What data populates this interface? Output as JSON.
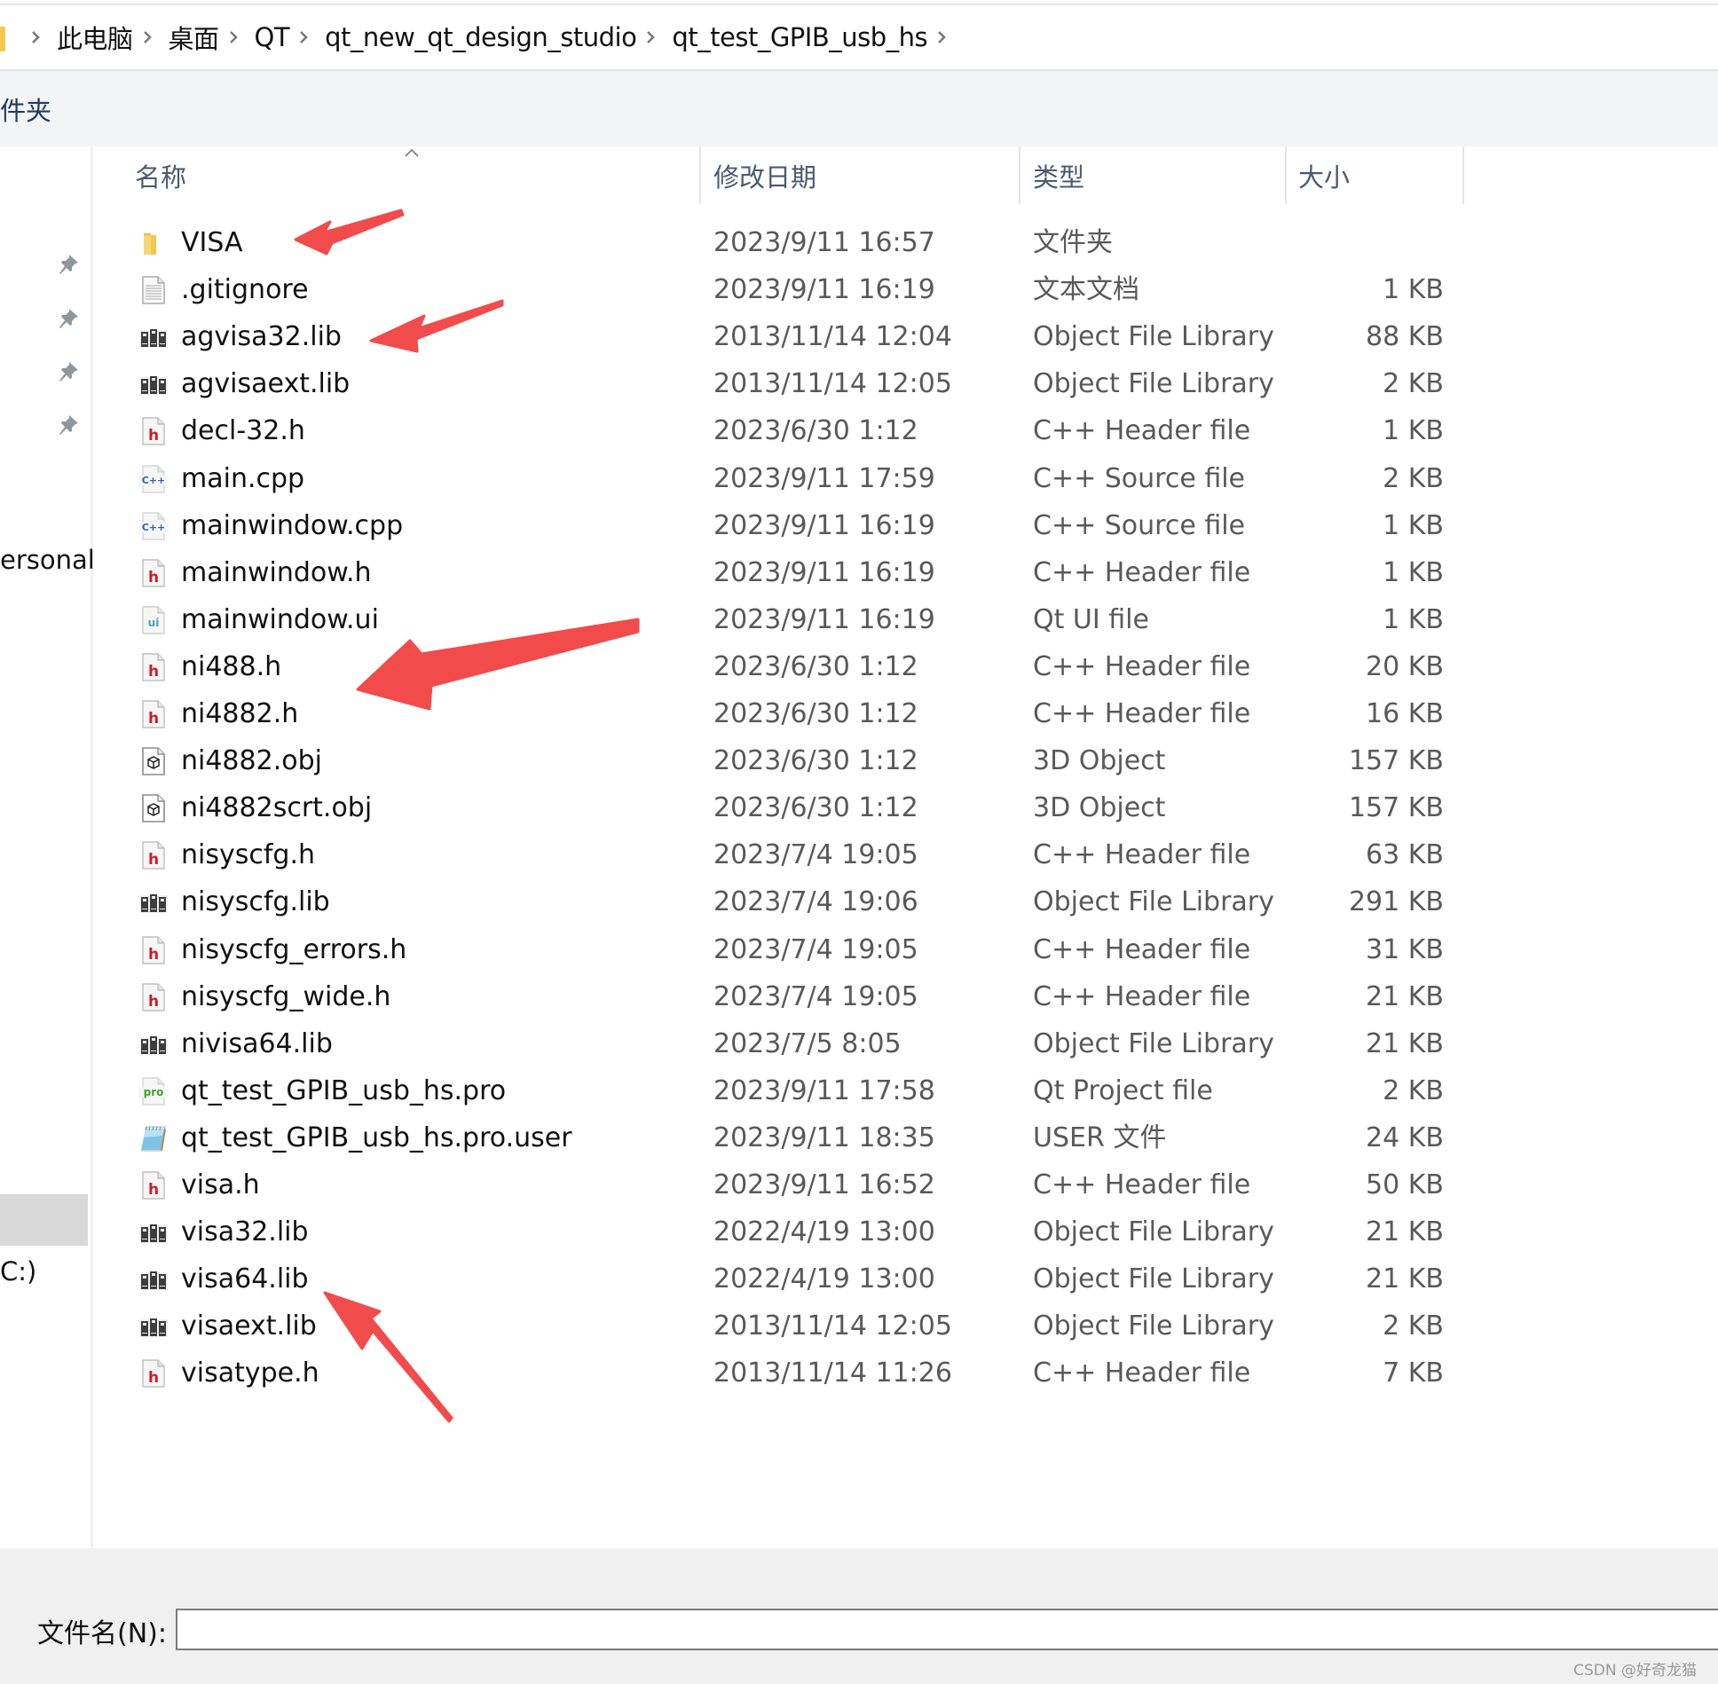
{
  "breadcrumb": {
    "items": [
      "此电脑",
      "桌面",
      "QT",
      "qt_new_qt_design_studio",
      "qt_test_GPIB_usb_hs"
    ]
  },
  "toolbar": {
    "label": "件夹"
  },
  "sidebar": {
    "pinned_count": 4,
    "labels": {
      "personal": "ersonal",
      "drive": "C:)"
    }
  },
  "columns": {
    "name": "名称",
    "date": "修改日期",
    "type": "类型",
    "size": "大小",
    "sort": "name-ascending"
  },
  "files": [
    {
      "name": "VISA",
      "date": "2023/9/11 16:57",
      "type": "文件夹",
      "size": "",
      "icon": "folder"
    },
    {
      "name": ".gitignore",
      "date": "2023/9/11 16:19",
      "type": "文本文档",
      "size": "1 KB",
      "icon": "text"
    },
    {
      "name": "agvisa32.lib",
      "date": "2013/11/14 12:04",
      "type": "Object File Library",
      "size": "88 KB",
      "icon": "lib"
    },
    {
      "name": "agvisaext.lib",
      "date": "2013/11/14 12:05",
      "type": "Object File Library",
      "size": "2 KB",
      "icon": "lib"
    },
    {
      "name": "decl-32.h",
      "date": "2023/6/30 1:12",
      "type": "C++ Header file",
      "size": "1 KB",
      "icon": "header"
    },
    {
      "name": "main.cpp",
      "date": "2023/9/11 17:59",
      "type": "C++ Source file",
      "size": "2 KB",
      "icon": "cpp"
    },
    {
      "name": "mainwindow.cpp",
      "date": "2023/9/11 16:19",
      "type": "C++ Source file",
      "size": "1 KB",
      "icon": "cpp"
    },
    {
      "name": "mainwindow.h",
      "date": "2023/9/11 16:19",
      "type": "C++ Header file",
      "size": "1 KB",
      "icon": "header"
    },
    {
      "name": "mainwindow.ui",
      "date": "2023/9/11 16:19",
      "type": "Qt UI file",
      "size": "1 KB",
      "icon": "ui"
    },
    {
      "name": "ni488.h",
      "date": "2023/6/30 1:12",
      "type": "C++ Header file",
      "size": "20 KB",
      "icon": "header"
    },
    {
      "name": "ni4882.h",
      "date": "2023/6/30 1:12",
      "type": "C++ Header file",
      "size": "16 KB",
      "icon": "header"
    },
    {
      "name": "ni4882.obj",
      "date": "2023/6/30 1:12",
      "type": "3D Object",
      "size": "157 KB",
      "icon": "obj3d"
    },
    {
      "name": "ni4882scrt.obj",
      "date": "2023/6/30 1:12",
      "type": "3D Object",
      "size": "157 KB",
      "icon": "obj3d"
    },
    {
      "name": "nisyscfg.h",
      "date": "2023/7/4 19:05",
      "type": "C++ Header file",
      "size": "63 KB",
      "icon": "header"
    },
    {
      "name": "nisyscfg.lib",
      "date": "2023/7/4 19:06",
      "type": "Object File Library",
      "size": "291 KB",
      "icon": "lib"
    },
    {
      "name": "nisyscfg_errors.h",
      "date": "2023/7/4 19:05",
      "type": "C++ Header file",
      "size": "31 KB",
      "icon": "header"
    },
    {
      "name": "nisyscfg_wide.h",
      "date": "2023/7/4 19:05",
      "type": "C++ Header file",
      "size": "21 KB",
      "icon": "header"
    },
    {
      "name": "nivisa64.lib",
      "date": "2023/7/5 8:05",
      "type": "Object File Library",
      "size": "21 KB",
      "icon": "lib"
    },
    {
      "name": "qt_test_GPIB_usb_hs.pro",
      "date": "2023/9/11 17:58",
      "type": "Qt Project file",
      "size": "2 KB",
      "icon": "pro"
    },
    {
      "name": "qt_test_GPIB_usb_hs.pro.user",
      "date": "2023/9/11 18:35",
      "type": "USER 文件",
      "size": "24 KB",
      "icon": "notepad"
    },
    {
      "name": "visa.h",
      "date": "2023/9/11 16:52",
      "type": "C++ Header file",
      "size": "50 KB",
      "icon": "header"
    },
    {
      "name": "visa32.lib",
      "date": "2022/4/19 13:00",
      "type": "Object File Library",
      "size": "21 KB",
      "icon": "lib"
    },
    {
      "name": "visa64.lib",
      "date": "2022/4/19 13:00",
      "type": "Object File Library",
      "size": "21 KB",
      "icon": "lib"
    },
    {
      "name": "visaext.lib",
      "date": "2013/11/14 12:05",
      "type": "Object File Library",
      "size": "2 KB",
      "icon": "lib"
    },
    {
      "name": "visatype.h",
      "date": "2013/11/14 11:26",
      "type": "C++ Header file",
      "size": "7 KB",
      "icon": "header"
    }
  ],
  "annotations": {
    "arrow_color": "#f24b4b",
    "arrow_targets": [
      "VISA",
      "agvisa32.lib",
      "ni488.h",
      "visa64.lib"
    ]
  },
  "footer": {
    "filename_label": "文件名(N):",
    "filename_value": "",
    "watermark": "CSDN @好奇龙猫"
  }
}
